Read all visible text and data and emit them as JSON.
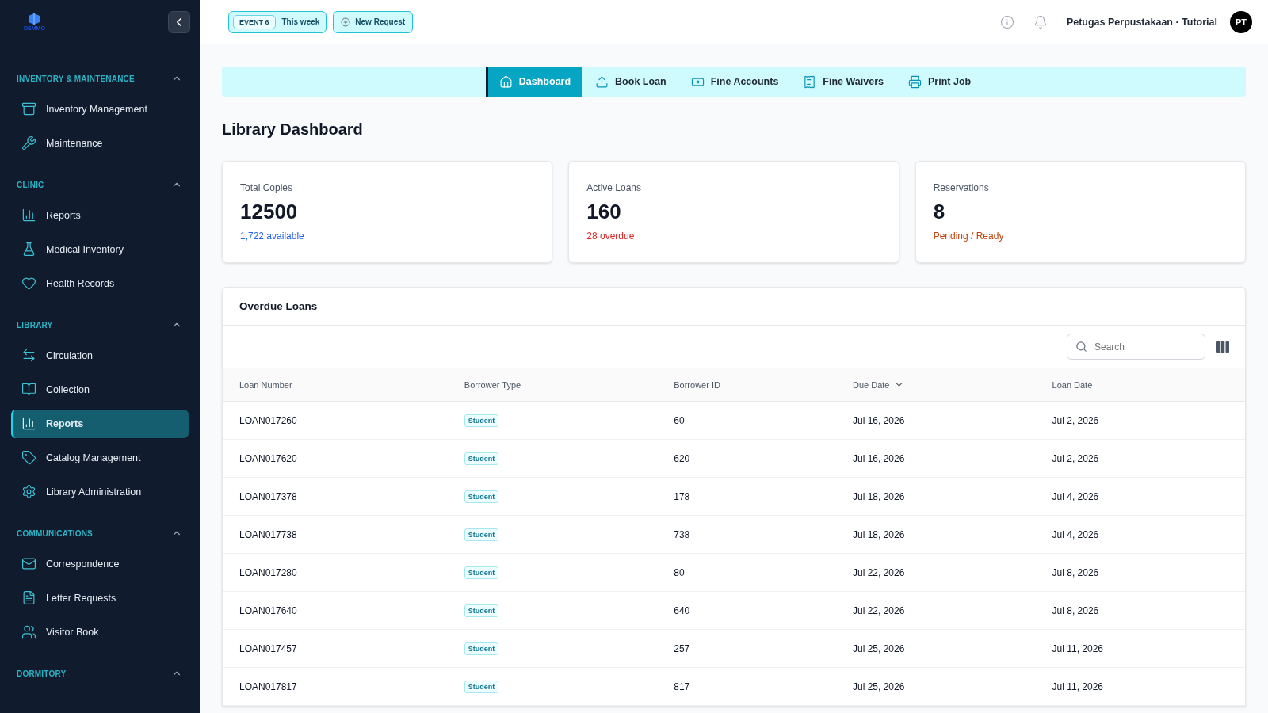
{
  "sidebar": {
    "logo": "DEMMO",
    "sections": [
      {
        "title": "INVENTORY & MAINTENANCE",
        "expanded": true,
        "items": [
          {
            "label": "Inventory Management",
            "selected": false
          },
          {
            "label": "Maintenance",
            "selected": false
          }
        ]
      },
      {
        "title": "CLINIC",
        "expanded": true,
        "items": [
          {
            "label": "Reports",
            "selected": false
          },
          {
            "label": "Medical Inventory",
            "selected": false
          },
          {
            "label": "Health Records",
            "selected": false
          }
        ]
      },
      {
        "title": "LIBRARY",
        "expanded": true,
        "items": [
          {
            "label": "Circulation",
            "selected": false
          },
          {
            "label": "Collection",
            "selected": false
          },
          {
            "label": "Reports",
            "selected": true
          },
          {
            "label": "Catalog Management",
            "selected": false
          },
          {
            "label": "Library Administration",
            "selected": false
          }
        ]
      },
      {
        "title": "COMMUNICATIONS",
        "expanded": true,
        "items": [
          {
            "label": "Correspondence",
            "selected": false
          },
          {
            "label": "Letter Requests",
            "selected": false
          },
          {
            "label": "Visitor Book",
            "selected": false
          }
        ]
      },
      {
        "title": "DORMITORY",
        "expanded": true
      }
    ]
  },
  "topbar": {
    "event_badge": "EVENT 6",
    "event_label": "This week",
    "new_request": "New Request",
    "user": "Petugas Perpustakaan · Tutorial",
    "avatar": "PT"
  },
  "tabs": [
    {
      "label": "Dashboard",
      "selected": true
    },
    {
      "label": "Book Loan",
      "selected": false
    },
    {
      "label": "Fine Accounts",
      "selected": false
    },
    {
      "label": "Fine Waivers",
      "selected": false
    },
    {
      "label": "Print Job",
      "selected": false
    }
  ],
  "title": "Library Dashboard",
  "stats": [
    {
      "label": "Total Copies",
      "value": "12500",
      "note": "1,722 available",
      "color": "#2563eb"
    },
    {
      "label": "Active Loans",
      "value": "160",
      "note": "28 overdue",
      "color": "#dc2626"
    },
    {
      "label": "Reservations",
      "value": "8",
      "note": "Pending / Ready",
      "color": "#c2410c"
    }
  ],
  "table": {
    "title": "Overdue Loans",
    "search_placeholder": "Search",
    "columns": [
      {
        "label": "Loan Number",
        "sorted": false
      },
      {
        "label": "Borrower Type",
        "sorted": false
      },
      {
        "label": "Borrower ID",
        "sorted": false
      },
      {
        "label": "Due Date",
        "sorted": true
      },
      {
        "label": "Loan Date",
        "sorted": false
      }
    ],
    "rows": [
      [
        "LOAN017260",
        "Student",
        "60",
        "Jul 16, 2026",
        "Jul 2, 2026"
      ],
      [
        "LOAN017620",
        "Student",
        "620",
        "Jul 16, 2026",
        "Jul 2, 2026"
      ],
      [
        "LOAN017378",
        "Student",
        "178",
        "Jul 18, 2026",
        "Jul 4, 2026"
      ],
      [
        "LOAN017738",
        "Student",
        "738",
        "Jul 18, 2026",
        "Jul 4, 2026"
      ],
      [
        "LOAN017280",
        "Student",
        "80",
        "Jul 22, 2026",
        "Jul 8, 2026"
      ],
      [
        "LOAN017640",
        "Student",
        "640",
        "Jul 22, 2026",
        "Jul 8, 2026"
      ],
      [
        "LOAN017457",
        "Student",
        "257",
        "Jul 25, 2026",
        "Jul 11, 2026"
      ],
      [
        "LOAN017817",
        "Student",
        "817",
        "Jul 25, 2026",
        "Jul 11, 2026"
      ]
    ]
  }
}
